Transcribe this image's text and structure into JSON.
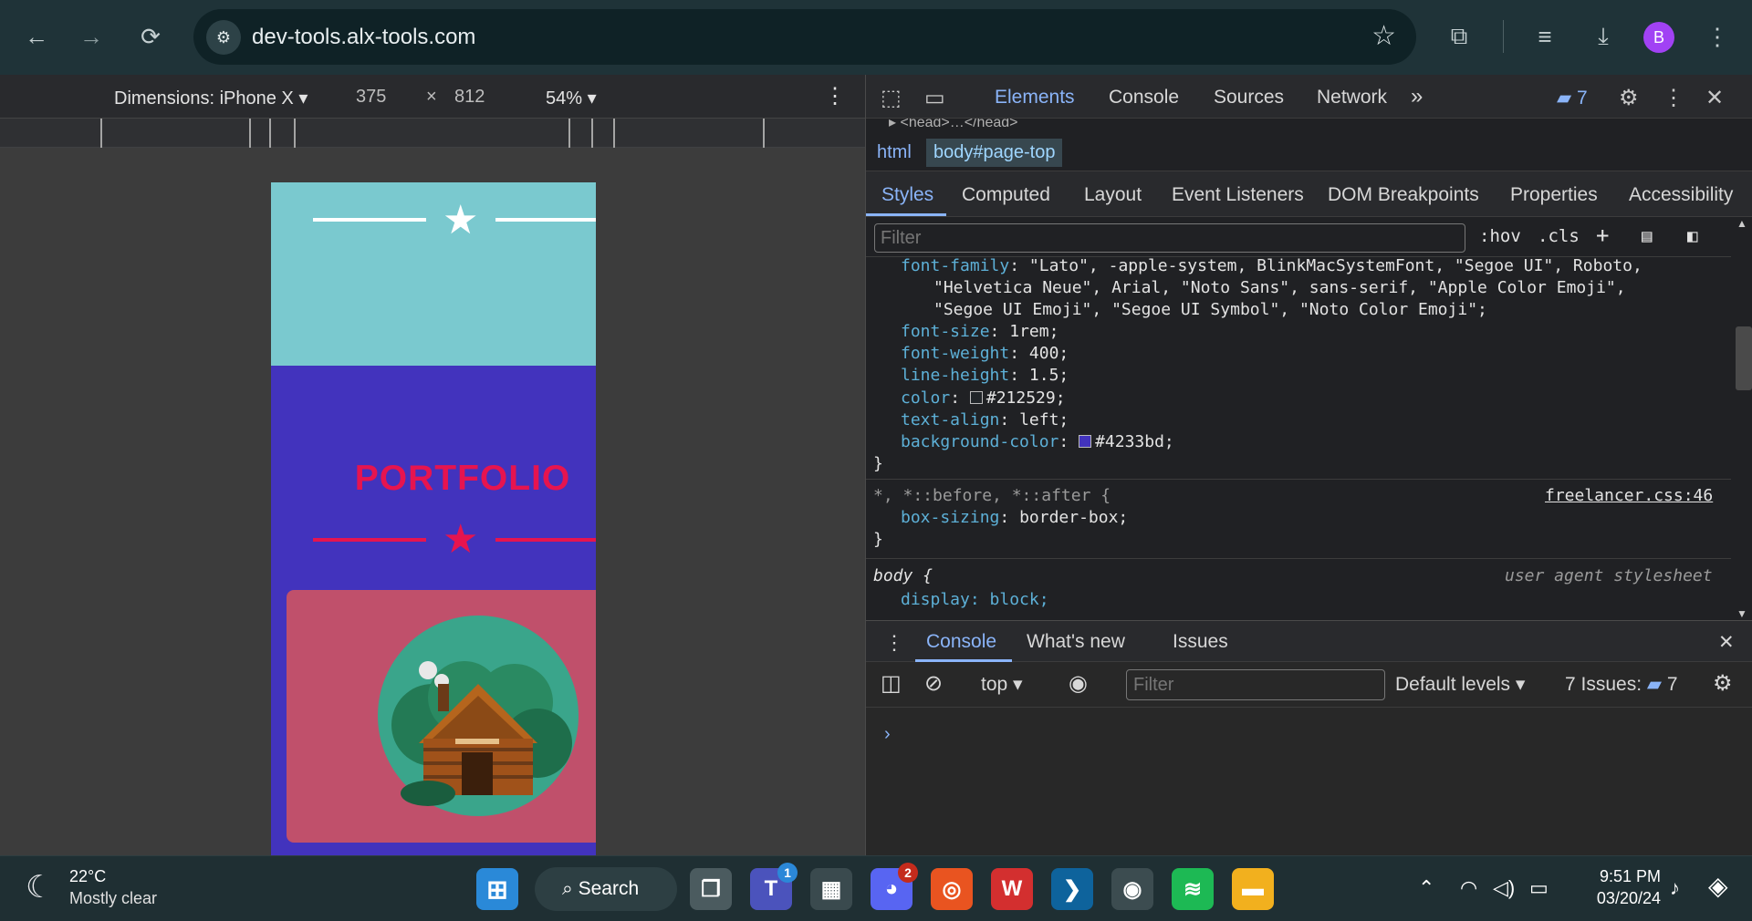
{
  "browser": {
    "url": "dev-tools.alx-tools.com",
    "nav": {
      "back_icon": "←",
      "forward_icon": "→",
      "reload_icon": "⟳"
    },
    "avatar_letter": "B"
  },
  "device_toolbar": {
    "dimensions_label": "Dimensions: iPhone X",
    "width": "375",
    "times": "×",
    "height": "812",
    "zoom": "54%"
  },
  "page_preview": {
    "heading": "PORTFOLIO",
    "colors": {
      "top_bg": "#7ac9cf",
      "main_bg": "#4233bd",
      "card_bg": "#c0506b",
      "heading": "#e6144f"
    }
  },
  "devtools": {
    "tabs": [
      "Elements",
      "Console",
      "Sources",
      "Network"
    ],
    "more": "»",
    "issues_count": "7",
    "dom_snippet": "▸ <head>…</head>",
    "breadcrumbs": [
      "html",
      "body#page-top"
    ],
    "sub_tabs": [
      "Styles",
      "Computed",
      "Layout",
      "Event Listeners",
      "DOM Breakpoints",
      "Properties",
      "Accessibility"
    ],
    "filter_placeholder": "Filter",
    "hov": ":hov",
    "cls": ".cls",
    "rules": {
      "body_font_family_prop": "font-family",
      "body_font_family_l1": "\"Lato\", -apple-system, BlinkMacSystemFont, \"Segoe UI\", Roboto,",
      "body_font_family_l2": "\"Helvetica Neue\", Arial, \"Noto Sans\", sans-serif, \"Apple Color Emoji\",",
      "body_font_family_l3": "\"Segoe UI Emoji\", \"Segoe UI Symbol\", \"Noto Color Emoji\";",
      "font_size_prop": "font-size",
      "font_size_val": "1rem;",
      "font_weight_prop": "font-weight",
      "font_weight_val": "400;",
      "line_height_prop": "line-height",
      "line_height_val": "1.5;",
      "color_prop": "color",
      "color_val": "#212529;",
      "text_align_prop": "text-align",
      "text_align_val": "left;",
      "bg_prop": "background-color",
      "bg_val": "#4233bd;",
      "close_brace": "}",
      "universal_selector": "*, *::before, *::after {",
      "universal_source": "freelancer.css:46",
      "box_sizing_prop": "box-sizing",
      "box_sizing_val": "border-box;",
      "body_selector": "body {",
      "body_source": "user agent stylesheet",
      "display_partial": "display: block;"
    },
    "swatch_colors": {
      "color": "#212529",
      "background": "#4233bd"
    }
  },
  "drawer": {
    "tabs": [
      "Console",
      "What's new",
      "Issues"
    ],
    "context": "top",
    "filter_placeholder": "Filter",
    "levels": "Default levels",
    "issues_label": "7 Issues:",
    "issues_count": "7",
    "prompt": "›"
  },
  "taskbar": {
    "temperature": "22°C",
    "weather": "Mostly clear",
    "search_label": "Search",
    "teams_badge": "1",
    "discord_badge": "2",
    "time": "9:51 PM",
    "date": "03/20/24"
  }
}
